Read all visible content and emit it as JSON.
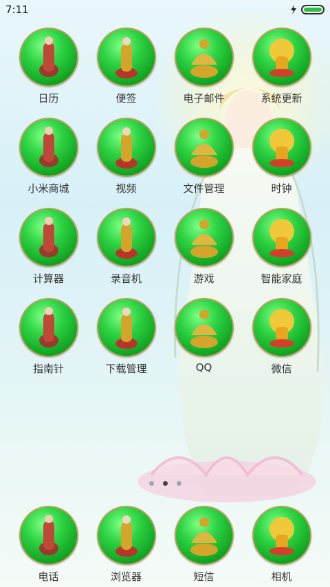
{
  "status_bar": {
    "time": "7:11",
    "battery_level": 1.0,
    "icons": [
      "charging-icon",
      "battery-icon"
    ]
  },
  "apps": [
    {
      "label": "日历",
      "icon": "statue-icon"
    },
    {
      "label": "便签",
      "icon": "statue-icon"
    },
    {
      "label": "电子邮件",
      "icon": "statue-icon"
    },
    {
      "label": "系统更新",
      "icon": "statue-icon"
    },
    {
      "label": "小米商城",
      "icon": "statue-icon"
    },
    {
      "label": "视频",
      "icon": "statue-icon"
    },
    {
      "label": "文件管理",
      "icon": "statue-icon"
    },
    {
      "label": "时钟",
      "icon": "statue-icon"
    },
    {
      "label": "计算器",
      "icon": "statue-icon"
    },
    {
      "label": "录音机",
      "icon": "statue-icon"
    },
    {
      "label": "游戏",
      "icon": "statue-icon"
    },
    {
      "label": "智能家庭",
      "icon": "statue-icon"
    },
    {
      "label": "指南针",
      "icon": "statue-icon"
    },
    {
      "label": "下载管理",
      "icon": "statue-icon"
    },
    {
      "label": "QQ",
      "icon": "statue-icon"
    },
    {
      "label": "微信",
      "icon": "statue-icon"
    }
  ],
  "page_indicator": {
    "count": 3,
    "active": 2
  },
  "dock": [
    {
      "label": "电话",
      "icon": "statue-icon"
    },
    {
      "label": "浏览器",
      "icon": "statue-icon"
    },
    {
      "label": "短信",
      "icon": "statue-icon"
    },
    {
      "label": "相机",
      "icon": "statue-icon"
    }
  ],
  "colors": {
    "icon_green": "#2fd444",
    "icon_rim": "#b9a05a",
    "statue_gold": "#d4a52a",
    "battery_green": "#2bbf45"
  }
}
